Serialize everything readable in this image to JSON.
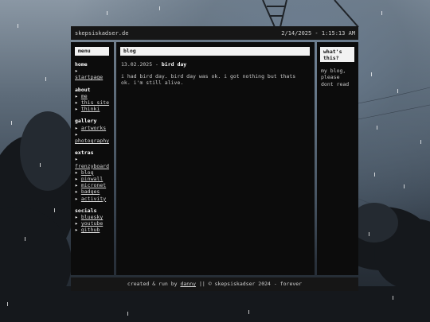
{
  "topbar": {
    "site_name": "skepsiskadser.de",
    "datetime": "2/14/2025 - 1:15:13 AM"
  },
  "menu": {
    "title": "menu",
    "sections": [
      {
        "heading": "home",
        "items": [
          "startpage"
        ]
      },
      {
        "heading": "about",
        "items": [
          "me",
          "this site",
          "thinki"
        ]
      },
      {
        "heading": "gallery",
        "items": [
          "artworks",
          "photography"
        ]
      },
      {
        "heading": "extras",
        "items": [
          "frenzyboard",
          "blog",
          "pinwall",
          "micronet",
          "badges",
          "activity"
        ]
      },
      {
        "heading": "socials",
        "items": [
          "bluesky",
          "youtube",
          "github"
        ]
      }
    ]
  },
  "main": {
    "title": "blog",
    "post_date": "13.02.2025 -",
    "post_title": "bird day",
    "post_body": "i had bird day. bird day was ok. i got nothing but thats ok. i'm still alive."
  },
  "aside": {
    "title_line1": "what's",
    "title_line2": "this?",
    "text_line1": "my blog,",
    "text_line2": "please",
    "text_line3": "dont read"
  },
  "footer": {
    "prefix": "created & run by",
    "author": "danny",
    "suffix": "|| © skepsiskadser 2024 - forever"
  },
  "colors": {
    "panel": "#0c0c0c",
    "bar": "#161616",
    "title_bg": "#f2f2f2"
  }
}
